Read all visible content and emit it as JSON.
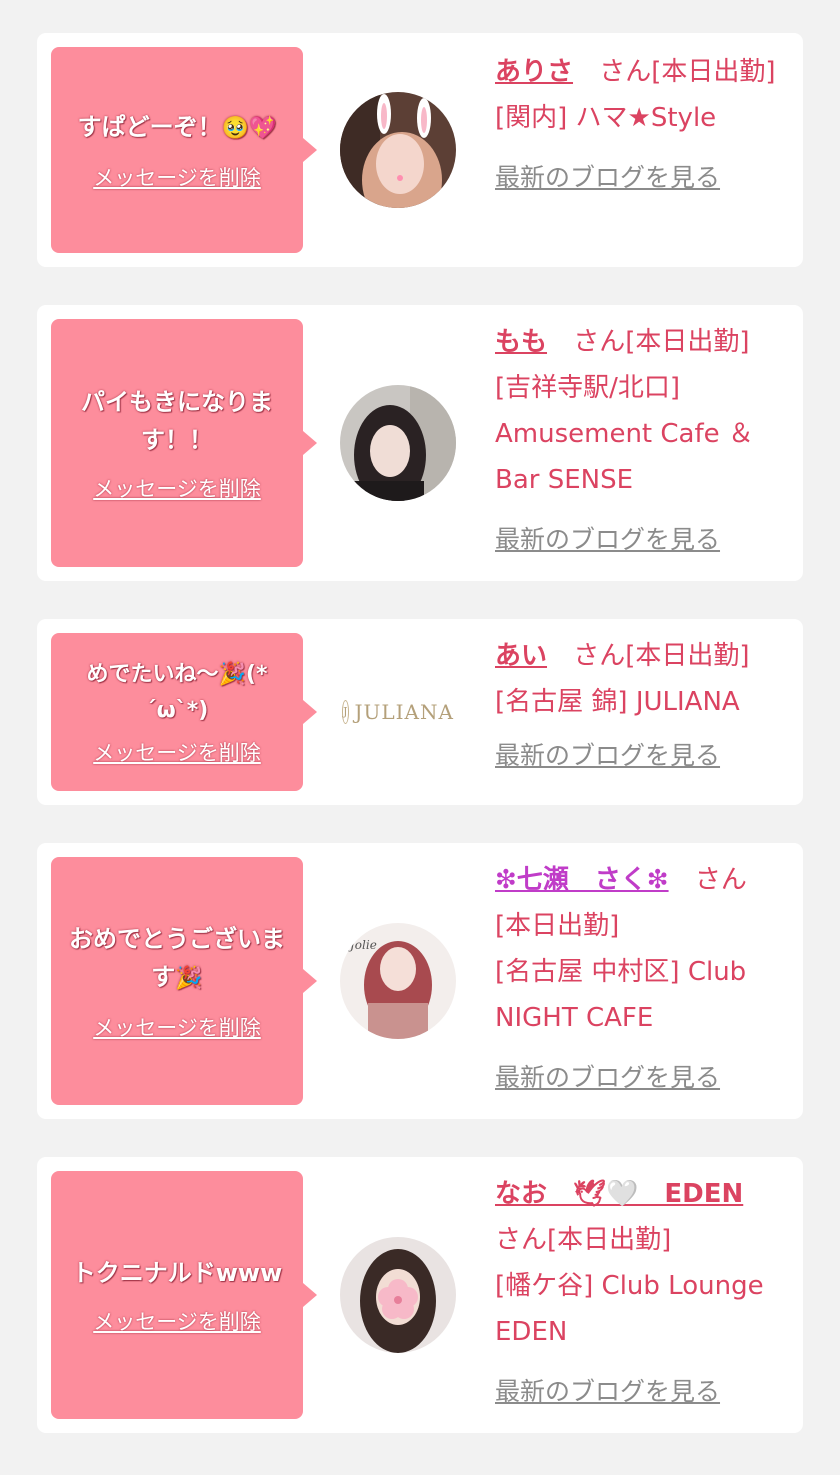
{
  "colors": {
    "accent": "#db4361",
    "bubble": "#fd8d9c",
    "blog_link": "#8b8b8b",
    "background": "#f2f2f2"
  },
  "cards": [
    {
      "message": "すぱどーぞ！",
      "message_emoji": "🥹💖",
      "delete_label": "メッセージを削除",
      "name": "ありさ",
      "suffix": "さん[本日出勤]",
      "shop": "[関内] ハマ★Style",
      "blog_label": "最新のブログを見る"
    },
    {
      "message": "パイもきになります！！",
      "delete_label": "メッセージを削除",
      "name": "もも",
      "suffix": "さん[本日出勤]",
      "shop": "[吉祥寺駅/北口] Amusement Cafe ＆Bar SENSE",
      "blog_label": "最新のブログを見る"
    },
    {
      "message": "めでたいね〜",
      "message_emoji": "🎉",
      "message_tail": "(*´ω`*)",
      "delete_label": "メッセージを削除",
      "logo_text": "JULIANA",
      "name": "あい",
      "suffix": "さん[本日出勤]",
      "shop": "[名古屋 錦] JULIANA",
      "blog_label": "最新のブログを見る"
    },
    {
      "message": "おめでとうございます",
      "message_emoji": "🎉",
      "delete_label": "メッセージを削除",
      "name": "❇七瀬　さく❇",
      "suffix": "さん[本日出勤]",
      "shop": "[名古屋 中村区] Club NIGHT CAFE",
      "blog_label": "最新のブログを見る"
    },
    {
      "message": "トクニナルドwww",
      "delete_label": "メッセージを削除",
      "name": "なお　🕊🤍　EDEN",
      "suffix": "さん[本日出勤]",
      "shop": "[幡ケ谷] Club Lounge EDEN",
      "blog_label": "最新のブログを見る"
    }
  ]
}
